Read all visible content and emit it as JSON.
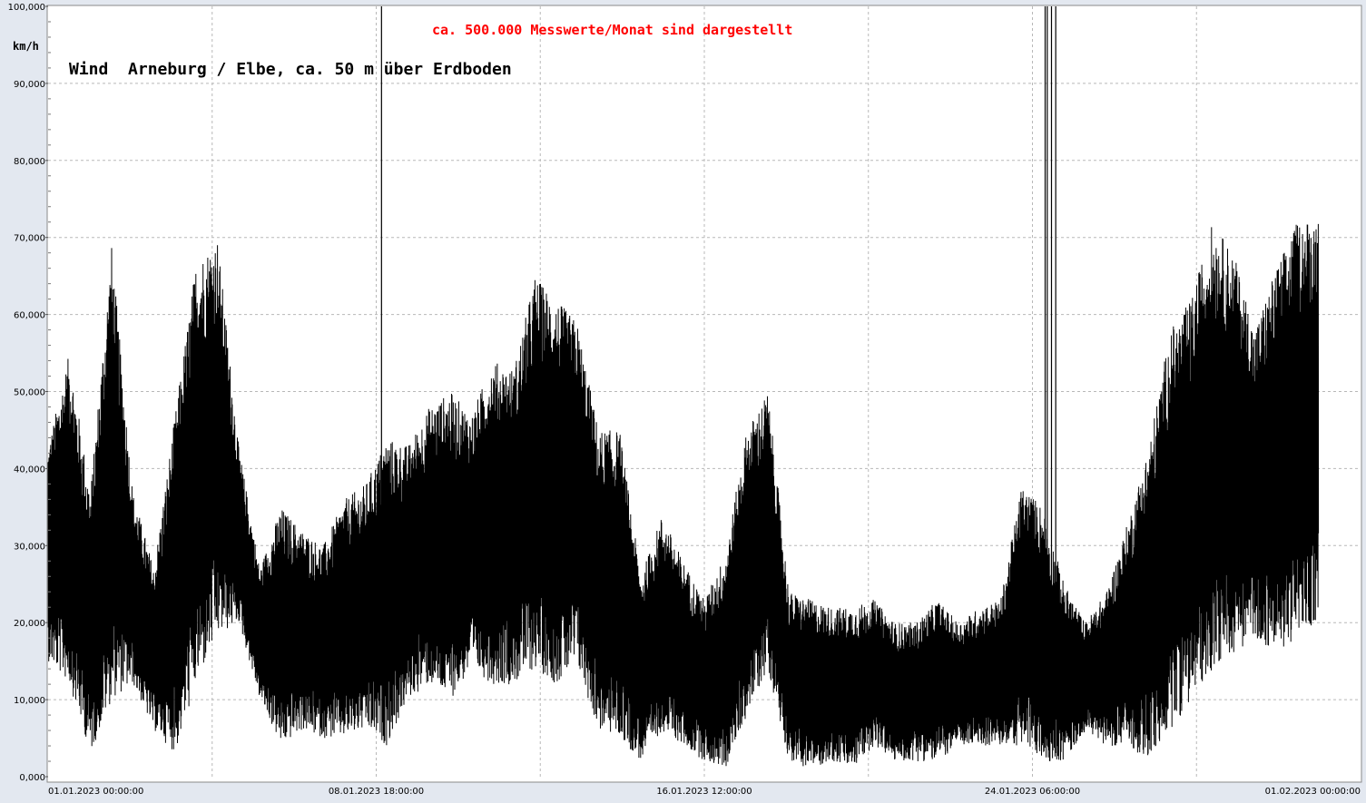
{
  "chart_data": {
    "type": "line",
    "title": "Wind  Arneburg / Elbe, ca. 50 m über Erdboden",
    "subtitle": "ca. 500.000 Messwerte/Monat sind dargestellt",
    "ylabel": "km/h",
    "xlabel": "",
    "ylim": [
      0,
      100
    ],
    "xlim": [
      "01.01.2023 00:00:00",
      "01.02.2023 00:00:00"
    ],
    "grid": true,
    "yticks": [
      "0,000",
      "10,000",
      "20,000",
      "30,000",
      "40,000",
      "50,000",
      "60,000",
      "70,000",
      "80,000",
      "90,000",
      "100,000"
    ],
    "xticks": [
      "01.01.2023  00:00:00",
      "08.01.2023  18:00:00",
      "16.01.2023  12:00:00",
      "24.01.2023  06:00:00",
      "01.02.2023  00:00:00"
    ],
    "series": [
      {
        "x": [
          0.0,
          0.5,
          1.0,
          1.5,
          2.0,
          2.5,
          3.0,
          3.5,
          4.0,
          4.5,
          5.0,
          5.5,
          6.0,
          6.5,
          7.0,
          7.5,
          8.0,
          8.5,
          9.0,
          9.5,
          10.0,
          10.5,
          11.0,
          11.5,
          12.0,
          12.5,
          13.0,
          13.5,
          14.0,
          14.5,
          15.0,
          15.5,
          16.0,
          16.5,
          17.0,
          17.5,
          18.0,
          18.5,
          19.0,
          19.5,
          20.0,
          20.5,
          21.0,
          21.5,
          22.0,
          22.5,
          23.0,
          23.5,
          24.0,
          24.5,
          25.0,
          25.5,
          26.0,
          26.5,
          27.0,
          27.5,
          28.0,
          28.5,
          29.0,
          29.5,
          30.0,
          30.5,
          31.0
        ],
        "min": [
          15,
          12,
          3,
          10,
          12,
          6,
          3,
          12,
          18,
          20,
          10,
          4,
          6,
          5,
          5,
          6,
          4,
          10,
          12,
          10,
          14,
          12,
          12,
          14,
          12,
          14,
          6,
          5,
          2,
          6,
          4,
          2,
          1,
          8,
          14,
          2,
          1,
          2,
          1,
          4,
          2,
          2,
          2,
          4,
          4,
          4,
          4,
          2,
          2,
          6,
          4,
          4,
          2,
          6,
          10,
          14,
          16,
          18,
          16,
          18,
          20
        ],
        "max": [
          43,
          55,
          37,
          69,
          37,
          27,
          47,
          67,
          70,
          43,
          27,
          35,
          32,
          30,
          36,
          38,
          44,
          43,
          48,
          50,
          47,
          54,
          53,
          65,
          62,
          59,
          45,
          45,
          26,
          34,
          28,
          23,
          29,
          45,
          50,
          24,
          23,
          22,
          22,
          23,
          20,
          20,
          23,
          20,
          22,
          23,
          38,
          35,
          25,
          20,
          24,
          33,
          43,
          58,
          62,
          72,
          68,
          58,
          66,
          72,
          73
        ]
      }
    ],
    "spikes": [
      {
        "x": 7.875,
        "y": 100
      },
      {
        "x": 23.55,
        "y": 100
      },
      {
        "x": 23.6,
        "y": 100
      },
      {
        "x": 23.7,
        "y": 100
      },
      {
        "x": 23.8,
        "y": 100
      }
    ]
  }
}
